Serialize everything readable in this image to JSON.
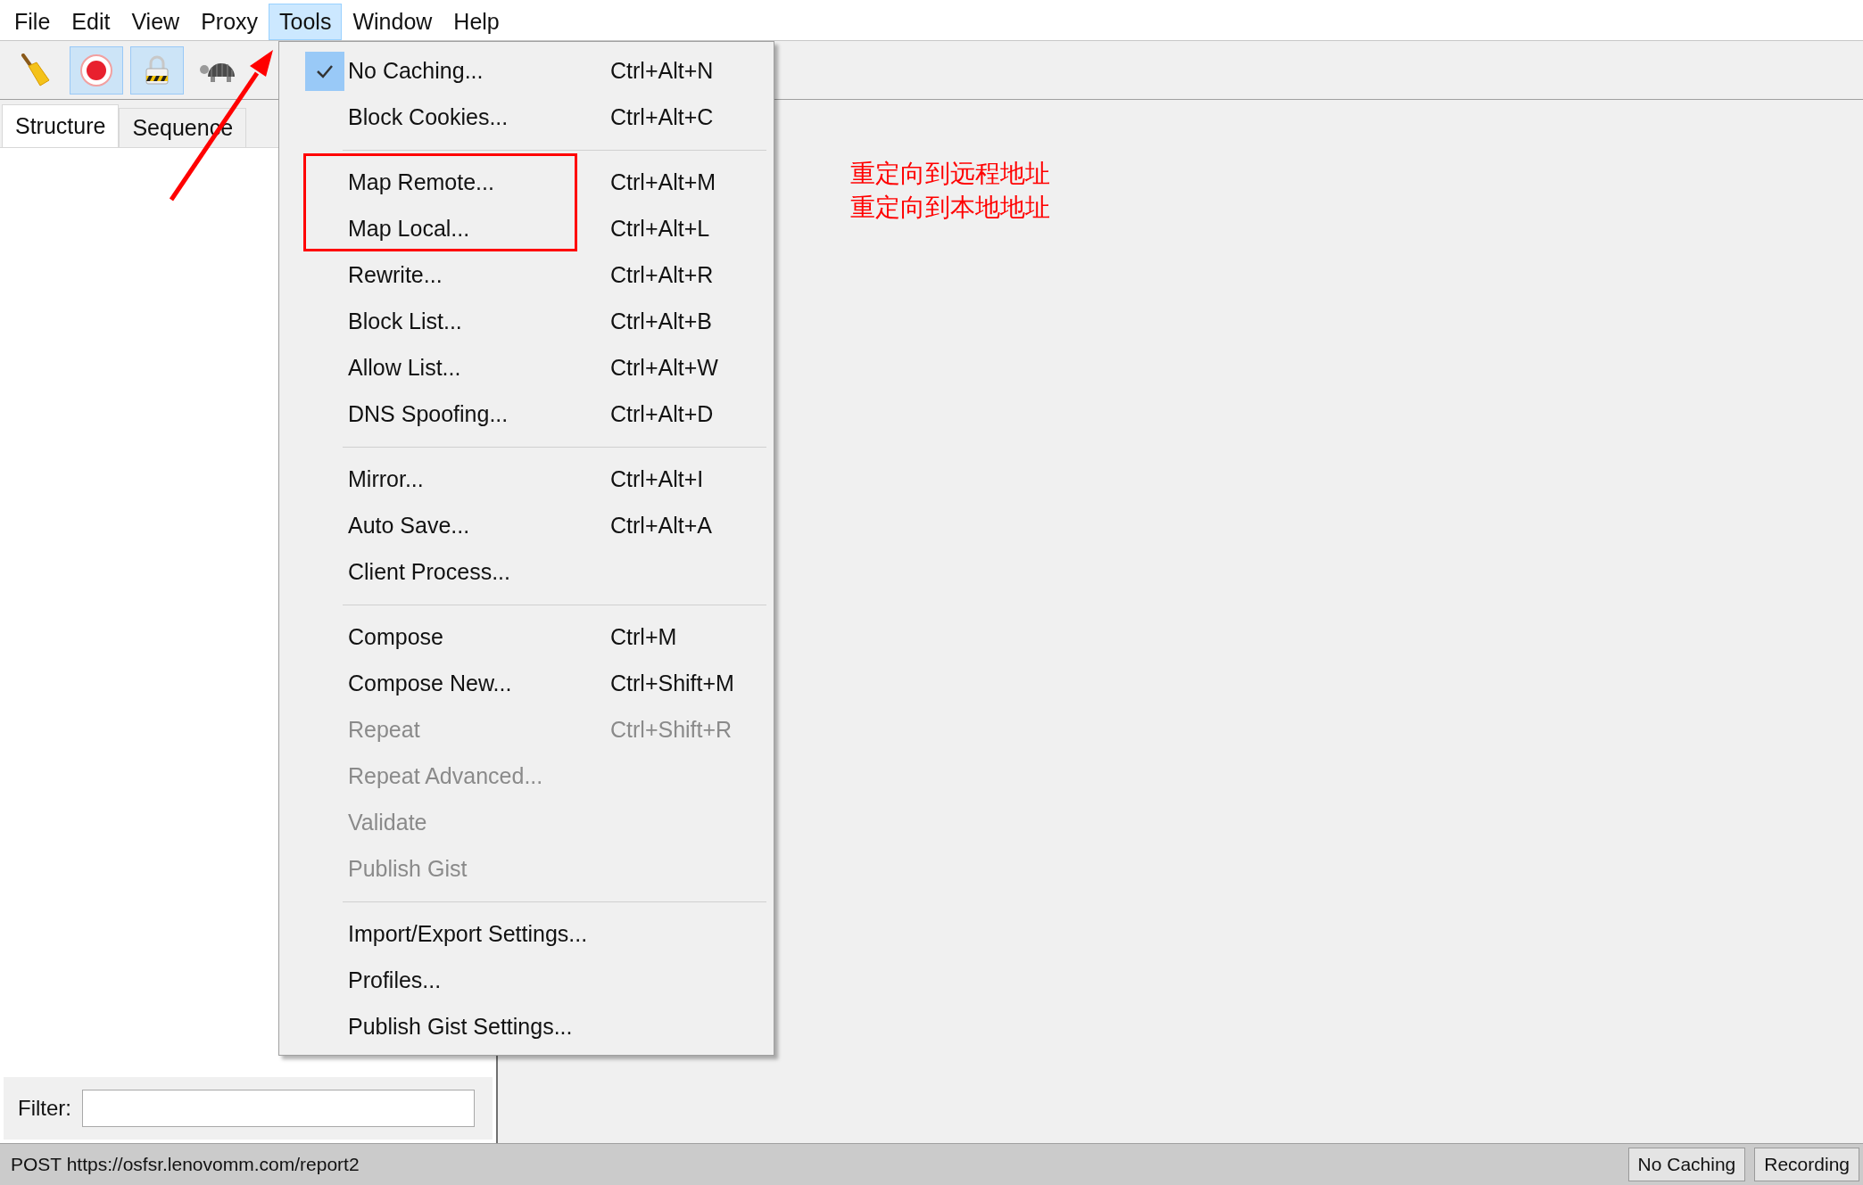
{
  "menu_bar": [
    {
      "label": "File",
      "selected": false
    },
    {
      "label": "Edit",
      "selected": false
    },
    {
      "label": "View",
      "selected": false
    },
    {
      "label": "Proxy",
      "selected": false
    },
    {
      "label": "Tools",
      "selected": true
    },
    {
      "label": "Window",
      "selected": false
    },
    {
      "label": "Help",
      "selected": false
    }
  ],
  "toolbar": [
    {
      "kind": "broom",
      "selected": false
    },
    {
      "kind": "record",
      "selected": true
    },
    {
      "kind": "lock",
      "selected": true
    },
    {
      "kind": "turtle",
      "selected": false
    }
  ],
  "tabs": [
    {
      "label": "Structure",
      "selected": true
    },
    {
      "label": "Sequence",
      "selected": false
    }
  ],
  "filter": {
    "label": "Filter:"
  },
  "status_bar": {
    "text": "POST https://osfsr.lenovomm.com/report2",
    "buttons": [
      "No Caching",
      "Recording"
    ]
  },
  "tools_menu": {
    "groups": [
      [
        {
          "label": "No Caching...",
          "shortcut": "Ctrl+Alt+N",
          "checked": true,
          "disabled": false
        },
        {
          "label": "Block Cookies...",
          "shortcut": "Ctrl+Alt+C",
          "checked": false,
          "disabled": false
        }
      ],
      [
        {
          "label": "Map Remote...",
          "shortcut": "Ctrl+Alt+M",
          "checked": false,
          "disabled": false
        },
        {
          "label": "Map Local...",
          "shortcut": "Ctrl+Alt+L",
          "checked": false,
          "disabled": false
        },
        {
          "label": "Rewrite...",
          "shortcut": "Ctrl+Alt+R",
          "checked": false,
          "disabled": false
        },
        {
          "label": "Block List...",
          "shortcut": "Ctrl+Alt+B",
          "checked": false,
          "disabled": false
        },
        {
          "label": "Allow List...",
          "shortcut": "Ctrl+Alt+W",
          "checked": false,
          "disabled": false
        },
        {
          "label": "DNS Spoofing...",
          "shortcut": "Ctrl+Alt+D",
          "checked": false,
          "disabled": false
        }
      ],
      [
        {
          "label": "Mirror...",
          "shortcut": "Ctrl+Alt+I",
          "checked": false,
          "disabled": false
        },
        {
          "label": "Auto Save...",
          "shortcut": "Ctrl+Alt+A",
          "checked": false,
          "disabled": false
        },
        {
          "label": "Client Process...",
          "checked": false,
          "disabled": false
        }
      ],
      [
        {
          "label": "Compose",
          "shortcut": "Ctrl+M",
          "checked": false,
          "disabled": false
        },
        {
          "label": "Compose New...",
          "shortcut": "Ctrl+Shift+M",
          "checked": false,
          "disabled": false
        },
        {
          "label": "Repeat",
          "shortcut": "Ctrl+Shift+R",
          "checked": false,
          "disabled": true
        },
        {
          "label": "Repeat Advanced...",
          "checked": false,
          "disabled": true
        },
        {
          "label": "Validate",
          "checked": false,
          "disabled": true
        },
        {
          "label": "Publish Gist",
          "checked": false,
          "disabled": true
        }
      ],
      [
        {
          "label": "Import/Export Settings...",
          "checked": false,
          "disabled": false
        },
        {
          "label": "Profiles...",
          "checked": false,
          "disabled": false
        },
        {
          "label": "Publish Gist Settings...",
          "checked": false,
          "disabled": false
        }
      ]
    ]
  },
  "annotation": {
    "lines": [
      "重定向到远程地址",
      "重定向到本地地址"
    ]
  }
}
